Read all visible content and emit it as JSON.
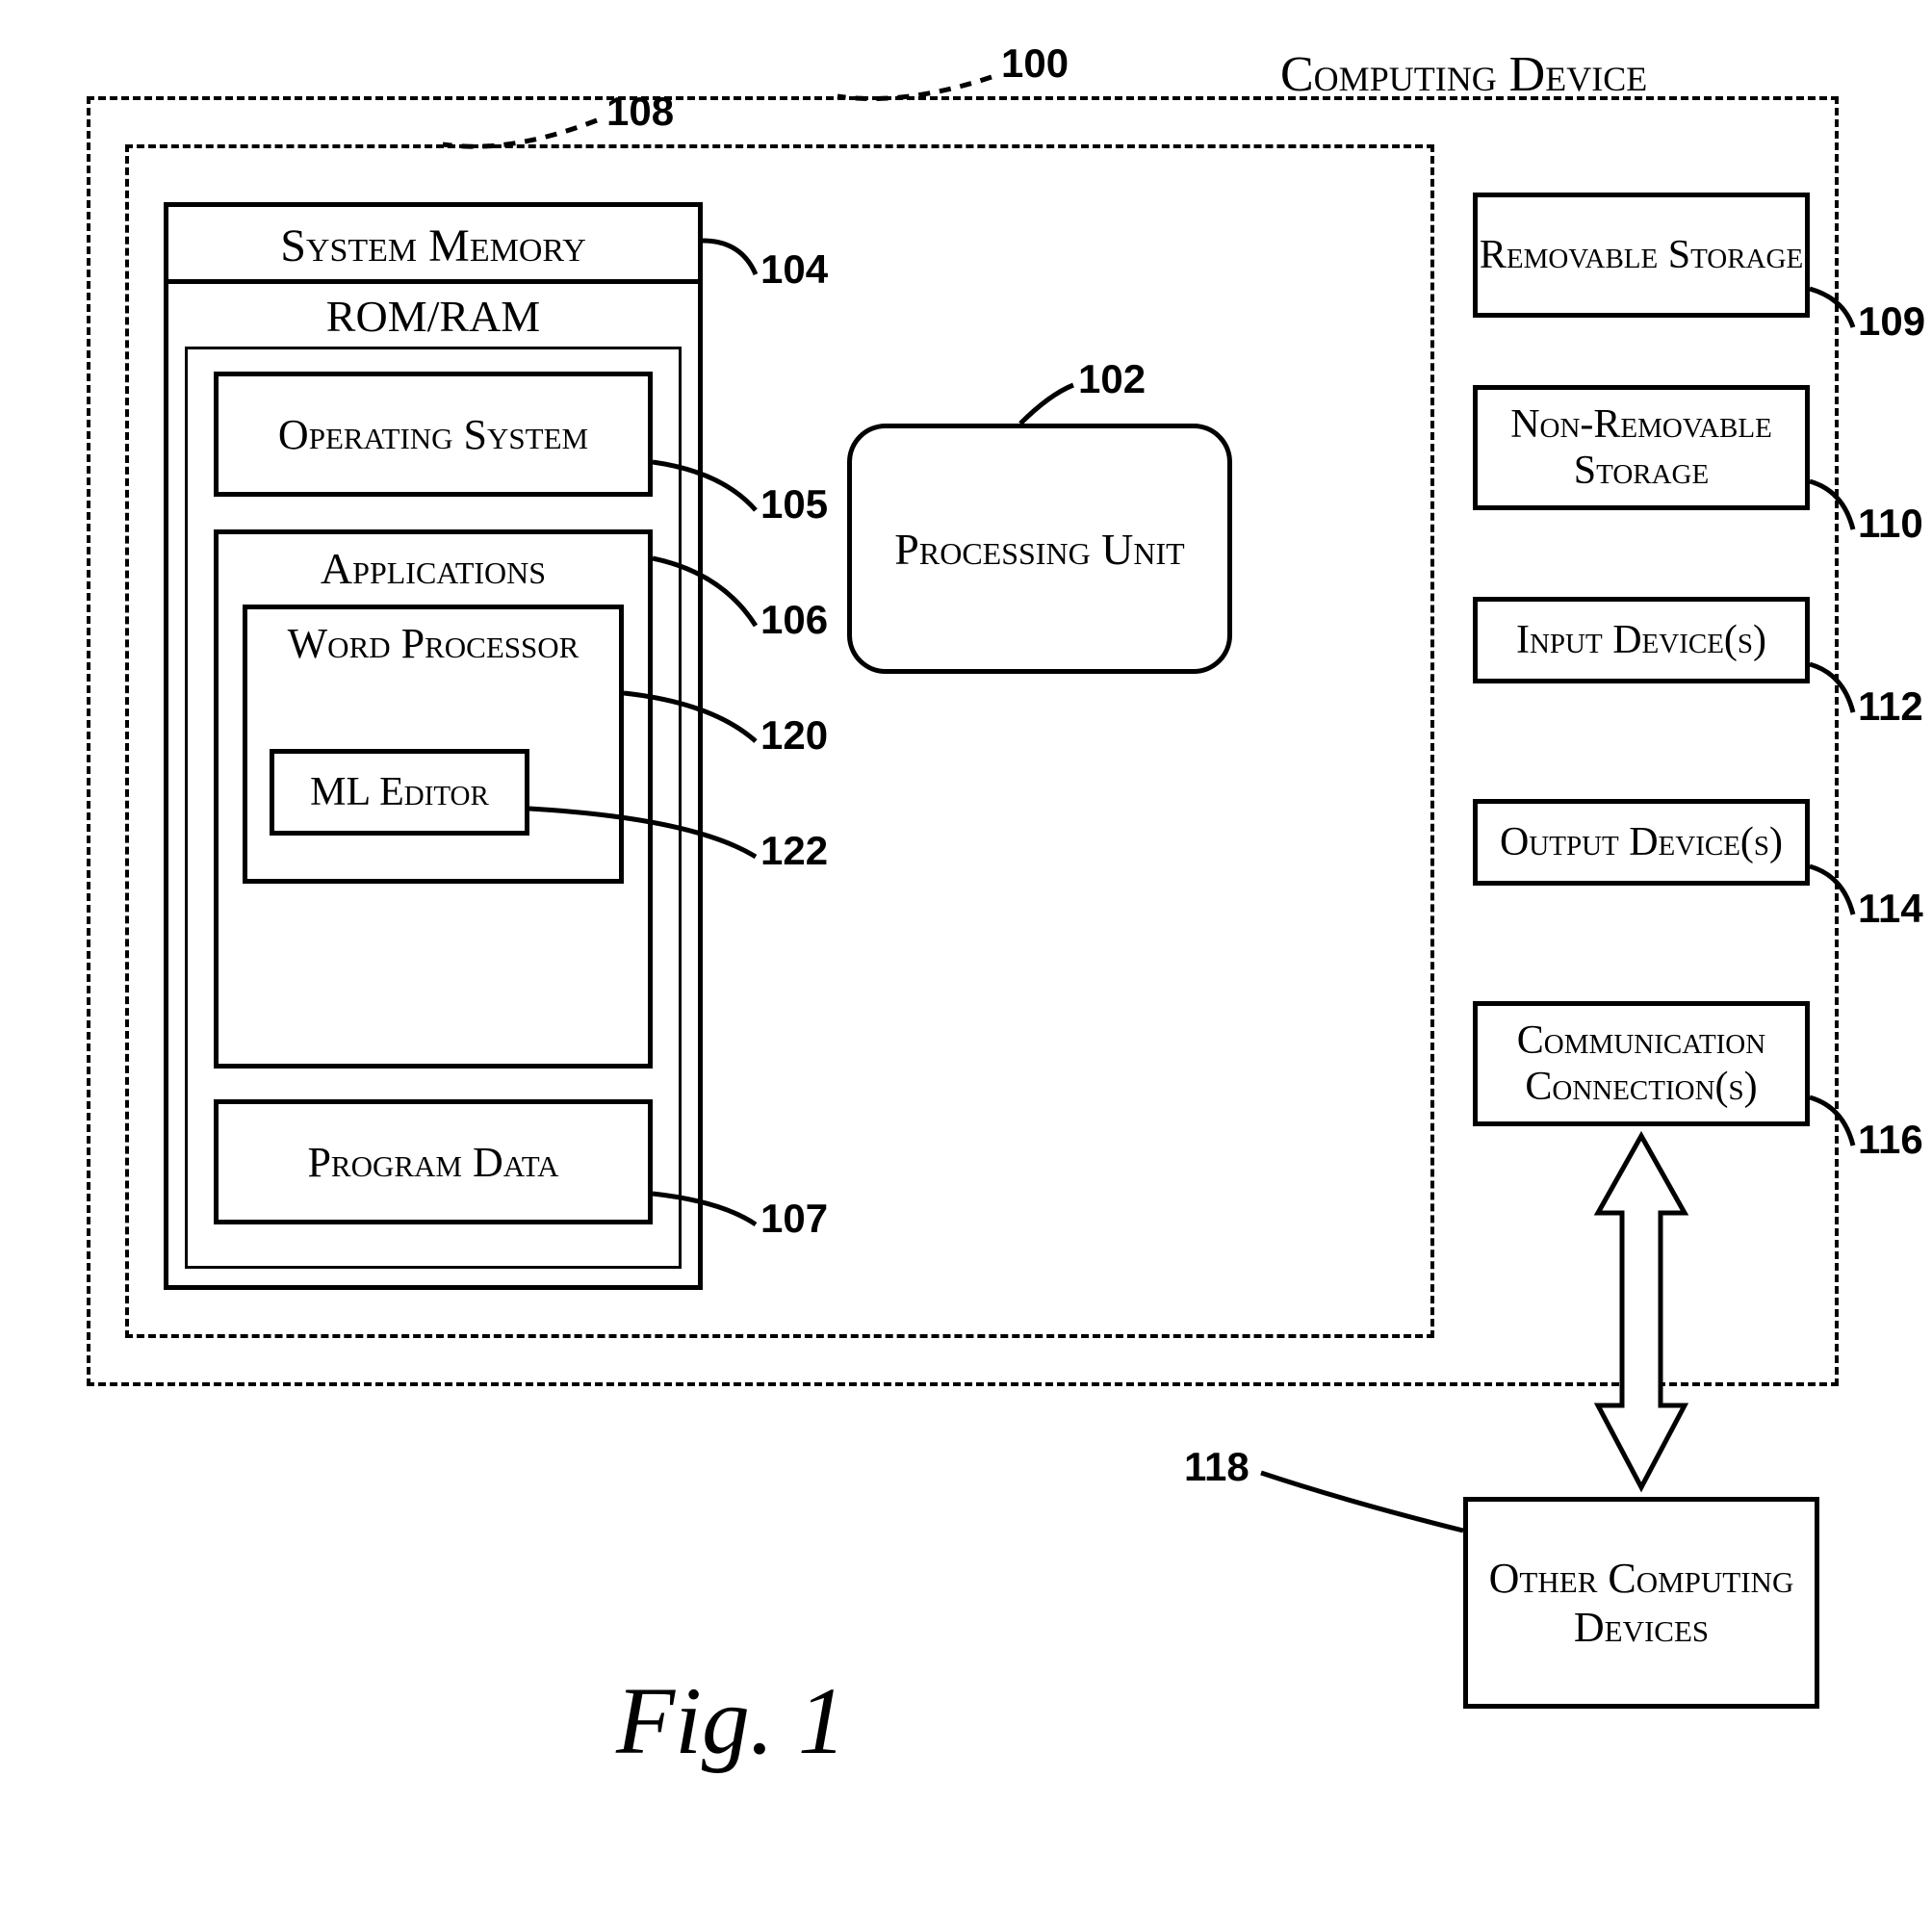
{
  "title": "Computing Device",
  "figure_label": "Fig. 1",
  "outer_ref": "100",
  "inner_ref": "108",
  "system_memory": {
    "title": "System Memory",
    "subtitle": "ROM/RAM",
    "ref": "104",
    "os": {
      "label": "Operating System",
      "ref": "105"
    },
    "apps": {
      "label": "Applications",
      "ref": "106",
      "word_processor": {
        "label": "Word Processor",
        "ref": "120"
      },
      "ml_editor": {
        "label": "ML Editor",
        "ref": "122"
      }
    },
    "program_data": {
      "label": "Program Data",
      "ref": "107"
    }
  },
  "processing_unit": {
    "label": "Processing Unit",
    "ref": "102"
  },
  "right": {
    "removable_storage": {
      "label": "Removable Storage",
      "ref": "109"
    },
    "non_removable_storage": {
      "label": "Non-Removable Storage",
      "ref": "110"
    },
    "input_devices": {
      "label": "Input Device(s)",
      "ref": "112"
    },
    "output_devices": {
      "label": "Output Device(s)",
      "ref": "114"
    },
    "communication": {
      "label": "Communication Connection(s)",
      "ref": "116"
    }
  },
  "other_devices": {
    "label": "Other Computing Devices",
    "ref": "118"
  }
}
